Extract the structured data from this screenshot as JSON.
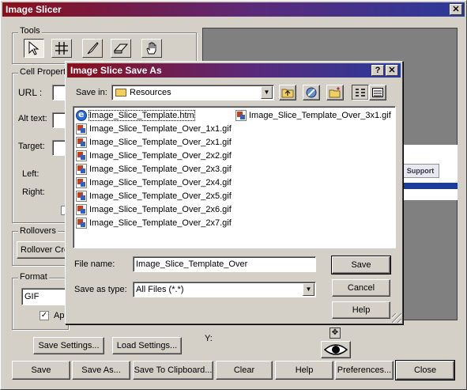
{
  "main_window": {
    "title": "Image Slicer",
    "close_glyph": "✕",
    "tools_label": "Tools",
    "tools": [
      "pointer-tool",
      "slice-grid-tool",
      "knife-tool",
      "eraser-tool",
      "hand-tool"
    ],
    "cell_properties_label": "Cell Properties",
    "url_label": "URL :",
    "alt_text_label": "Alt text:",
    "target_label": "Target:",
    "left_label": "Left:",
    "right_label": "Right:",
    "rollovers_label": "Rollovers",
    "rollover_button": "Rollover Cre",
    "format_label": "Format",
    "format_value": "GIF",
    "apply_label": "Ap",
    "y_label": "Y:",
    "preview_support_tab": "Support",
    "save_settings": "Save Settings...",
    "load_settings": "Load Settings...",
    "bottom_buttons": {
      "save": "Save",
      "save_as": "Save As...",
      "save_to_clipboard": "Save To Clipboard...",
      "clear": "Clear",
      "help": "Help",
      "preferences": "Preferences...",
      "close": "Close"
    }
  },
  "dialog": {
    "title": "Image Slice Save As",
    "help_glyph": "?",
    "close_glyph": "✕",
    "save_in_label": "Save in:",
    "save_in_value": "Resources",
    "files_col1": [
      {
        "name": "Image_Slice_Template.htm",
        "type": "htm"
      },
      {
        "name": "Image_Slice_Template_Over_1x1.gif",
        "type": "gif"
      },
      {
        "name": "Image_Slice_Template_Over_2x1.gif",
        "type": "gif"
      },
      {
        "name": "Image_Slice_Template_Over_2x2.gif",
        "type": "gif"
      },
      {
        "name": "Image_Slice_Template_Over_2x3.gif",
        "type": "gif"
      },
      {
        "name": "Image_Slice_Template_Over_2x4.gif",
        "type": "gif"
      },
      {
        "name": "Image_Slice_Template_Over_2x5.gif",
        "type": "gif"
      },
      {
        "name": "Image_Slice_Template_Over_2x6.gif",
        "type": "gif"
      },
      {
        "name": "Image_Slice_Template_Over_2x7.gif",
        "type": "gif"
      }
    ],
    "files_col2": [
      {
        "name": "Image_Slice_Template_Over_3x1.gif",
        "type": "gif"
      }
    ],
    "file_name_label": "File name:",
    "file_name_value": "Image_Slice_Template_Over",
    "save_as_type_label": "Save as type:",
    "save_as_type_value": "All Files (*.*)",
    "save_button": "Save",
    "cancel_button": "Cancel",
    "help_button": "Help"
  }
}
